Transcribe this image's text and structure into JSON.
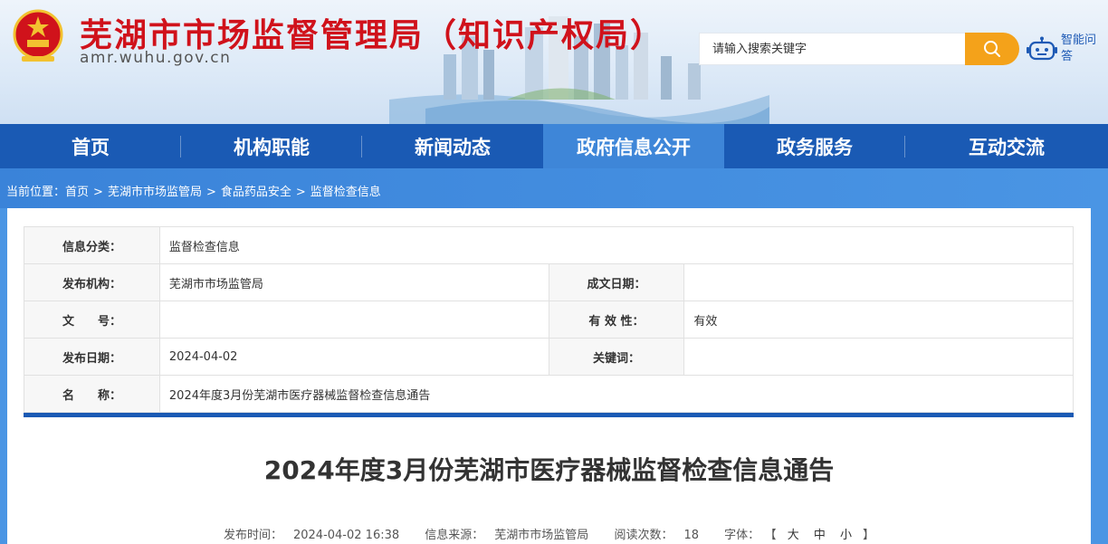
{
  "header": {
    "title": "芜湖市市场监督管理局（知识产权局）",
    "domain": "amr.wuhu.gov.cn",
    "search_placeholder": "请输入搜索关键字",
    "assistant_label": "智能问答",
    "brand_red": "#d0121b",
    "search_btn_color": "#f4a21a"
  },
  "nav": {
    "items": [
      "首页",
      "机构职能",
      "新闻动态",
      "政府信息公开",
      "政务服务",
      "互动交流"
    ],
    "active": "政府信息公开",
    "color": "#1a5ab4",
    "active_color": "#3e86d8"
  },
  "breadcrumb": {
    "prefix": "当前位置：",
    "items": [
      "首页",
      "芜湖市市场监管局",
      "食品药品安全",
      "监督检查信息"
    ],
    "separator": ">"
  },
  "info": {
    "category_label": "信息分类：",
    "category": "监督检查信息",
    "publisher_label": "发布机构：",
    "publisher": "芜湖市市场监管局",
    "created_label": "成文日期：",
    "created": "",
    "doc_no_label": "文　　号：",
    "doc_no": "",
    "validity_label": "有 效 性：",
    "validity": "有效",
    "pub_date_label": "发布日期：",
    "pub_date": "2024-04-02",
    "keywords_label": "关键词：",
    "keywords": "",
    "name_label": "名　　称：",
    "name": "2024年度3月份芜湖市医疗器械监督检查信息通告"
  },
  "article": {
    "title": "2024年度3月份芜湖市医疗器械监督检查信息通告",
    "publish_time_label": "发布时间：",
    "publish_time": "2024-04-02 16:38",
    "source_label": "信息来源：",
    "source": "芜湖市市场监管局",
    "views_label": "阅读次数：",
    "views": "18",
    "font_label": "字体：",
    "font_open": "【",
    "font_large": "大",
    "font_medium": "中",
    "font_small": "小",
    "font_close": "】"
  }
}
